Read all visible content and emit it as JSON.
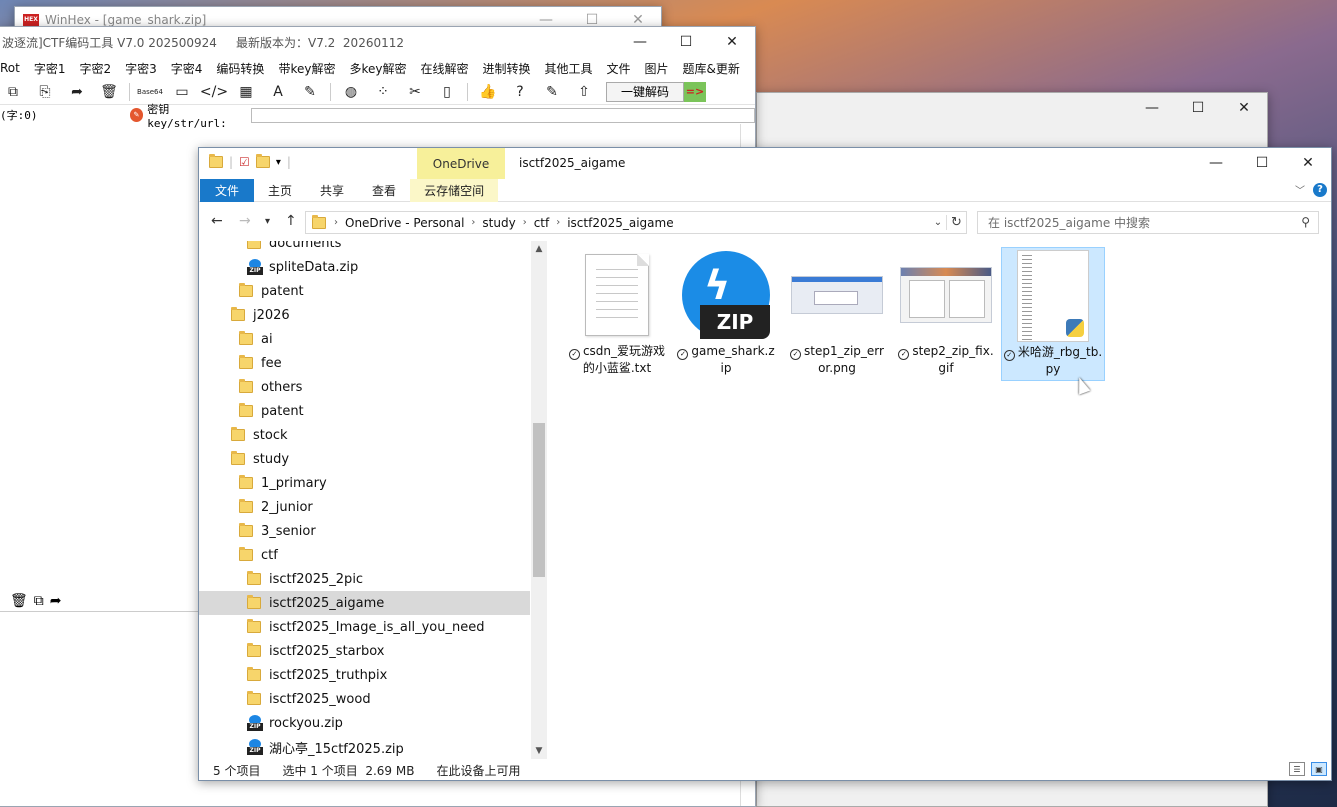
{
  "winhex": {
    "title": "WinHex - [game_shark.zip]",
    "logo": "HEX"
  },
  "ctf_tool": {
    "title": "波逐流]CTF编码工具 V7.0 202500924     最新版本为：V7.2  20260112",
    "menu": [
      "Rot",
      "字密1",
      "字密2",
      "字密3",
      "字密4",
      "编码转换",
      "带key解密",
      "多key解密",
      "在线解密",
      "进制转换",
      "其他工具",
      "文件",
      "图片",
      "题库&更新"
    ],
    "toolbar": {
      "base64_label": "Base64",
      "onekey_label": "一键解码",
      "arrow_label": "=>"
    },
    "char_count": "(字:0)",
    "key_label": "密钥key/str/url:",
    "key_value": ""
  },
  "explorer": {
    "title": "isctf2025_aigame",
    "onedrive_tab": "OneDrive",
    "ribbon_tabs": [
      "文件",
      "主页",
      "共享",
      "查看",
      "云存储空间"
    ],
    "breadcrumb": [
      "OneDrive - Personal",
      "study",
      "ctf",
      "isctf2025_aigame"
    ],
    "search_placeholder": "在 isctf2025_aigame 中搜索",
    "tree": [
      {
        "label": "documents",
        "type": "folder",
        "indent": 2
      },
      {
        "label": "spliteData.zip",
        "type": "zip",
        "indent": 2
      },
      {
        "label": "patent",
        "type": "folder",
        "indent": 1
      },
      {
        "label": "j2026",
        "type": "folder",
        "indent": 0
      },
      {
        "label": "ai",
        "type": "folder",
        "indent": 1
      },
      {
        "label": "fee",
        "type": "folder",
        "indent": 1
      },
      {
        "label": "others",
        "type": "folder",
        "indent": 1
      },
      {
        "label": "patent",
        "type": "folder",
        "indent": 1
      },
      {
        "label": "stock",
        "type": "folder",
        "indent": 0
      },
      {
        "label": "study",
        "type": "folder",
        "indent": 0
      },
      {
        "label": "1_primary",
        "type": "folder",
        "indent": 1
      },
      {
        "label": "2_junior",
        "type": "folder",
        "indent": 1
      },
      {
        "label": "3_senior",
        "type": "folder",
        "indent": 1
      },
      {
        "label": "ctf",
        "type": "folder",
        "indent": 1
      },
      {
        "label": "isctf2025_2pic",
        "type": "folder",
        "indent": 2
      },
      {
        "label": "isctf2025_aigame",
        "type": "folder",
        "indent": 2,
        "selected": true
      },
      {
        "label": "isctf2025_Image_is_all_you_need",
        "type": "folder",
        "indent": 2
      },
      {
        "label": "isctf2025_starbox",
        "type": "folder",
        "indent": 2
      },
      {
        "label": "isctf2025_truthpix",
        "type": "folder",
        "indent": 2
      },
      {
        "label": "isctf2025_wood",
        "type": "folder",
        "indent": 2
      },
      {
        "label": "rockyou.zip",
        "type": "zip",
        "indent": 2
      },
      {
        "label": "湖心亭_15ctf2025.zip",
        "type": "zip",
        "indent": 2
      }
    ],
    "files": [
      {
        "name": "csdn_爱玩游戏的小蓝鲨.txt",
        "kind": "txt"
      },
      {
        "name": "game_shark.zip",
        "kind": "zip"
      },
      {
        "name": "step1_zip_error.png",
        "kind": "png"
      },
      {
        "name": "step2_zip_fix.gif",
        "kind": "gif"
      },
      {
        "name": "米哈游_rbg_tb.py",
        "kind": "py",
        "selected": true
      }
    ],
    "zip_badge": "ZIP",
    "status": {
      "count": "5 个项目",
      "selection": "选中 1 个项目  2.69 MB",
      "availability": "在此设备上可用"
    }
  }
}
